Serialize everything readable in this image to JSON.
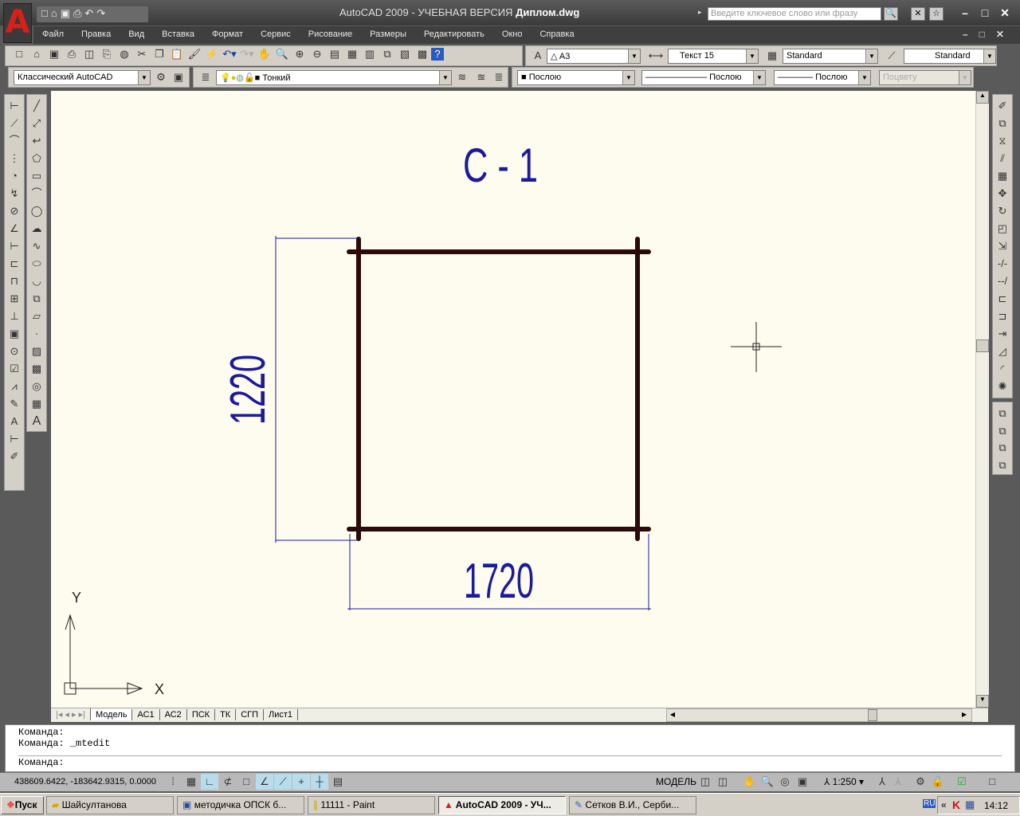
{
  "titlebar": {
    "app": "AutoCAD 2009 - УЧЕБНАЯ ВЕРСИЯ",
    "file": "Диплом.dwg",
    "search_placeholder": "Введите ключевое слово или фразу"
  },
  "menu": [
    "Файл",
    "Правка",
    "Вид",
    "Вставка",
    "Формат",
    "Сервис",
    "Рисование",
    "Размеры",
    "Редактировать",
    "Окно",
    "Справка"
  ],
  "styles": {
    "text_style": "A3",
    "dim_style": "Текст 15",
    "table_style": "Standard",
    "mleader_style": "Standard"
  },
  "workspace": "Классический AutoCAD",
  "layer": "Тонкий",
  "properties": {
    "color": "Послою",
    "linetype": "Послою",
    "lineweight": "Послою",
    "plotstyle": "Поцвету"
  },
  "drawing": {
    "title": "С - 1",
    "dim_vertical": "1220",
    "dim_horizontal": "1720",
    "ucs_x": "X",
    "ucs_y": "Y"
  },
  "tabs": [
    "Модель",
    "АС1",
    "АС2",
    "ПСК",
    "ТК",
    "СГП",
    "Лист1"
  ],
  "command": {
    "lines": [
      "Команда:",
      "Команда: _mtedit"
    ],
    "prompt": "Команда:"
  },
  "status": {
    "coords": "438609.6422, -183642.9315, 0.0000",
    "space": "МОДЕЛЬ",
    "scale": "1:250"
  },
  "taskbar": {
    "start": "Пуск",
    "items": [
      "Шайсултанова",
      "методичка ОПСК б...",
      "11111 - Paint",
      "AutoCAD 2009 - УЧ...",
      "Сетков В.И., Серби..."
    ],
    "lang": "RU",
    "time": "14:12"
  },
  "colors": {
    "canvas": "#fdfcee",
    "annotation": "#1a1aa0",
    "geometry": "#2a0a0a"
  }
}
